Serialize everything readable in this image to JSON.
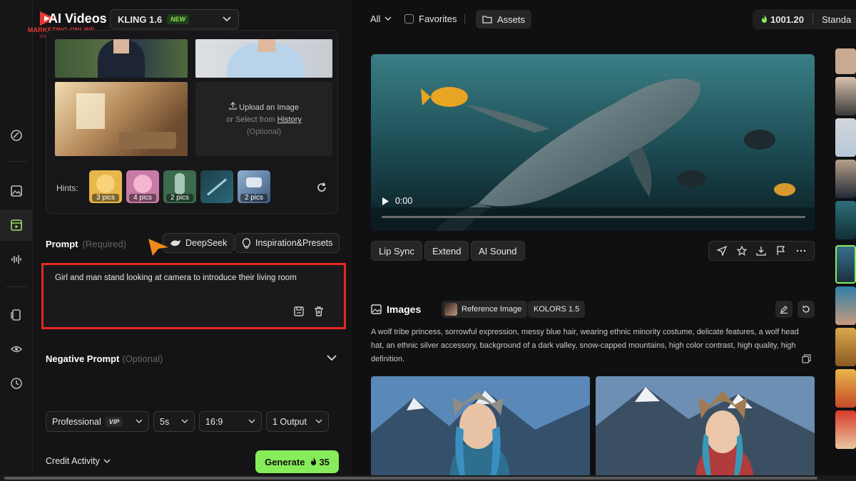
{
  "logo": {
    "line1": "MARKETING ONLINE",
    "line2": "Vươn Xa Cùng Bạn"
  },
  "header": {
    "title": "AI Videos",
    "model": "KLING 1.6",
    "model_badge": "NEW"
  },
  "upload": {
    "line1": "Upload an Image",
    "line2_prefix": "or Select from",
    "line2_link": "History",
    "line3": "(Optional)"
  },
  "hints": {
    "label": "Hints:",
    "items": [
      {
        "count": "3 pics",
        "color": "#e8b64a"
      },
      {
        "count": "4 pics",
        "color": "#c97aa6"
      },
      {
        "count": "2 pics",
        "color": "#3c6a4c"
      },
      {
        "count": "",
        "color": "#2b6a78"
      },
      {
        "count": "2 pics",
        "color": "#5f7fa6"
      }
    ]
  },
  "prompt": {
    "label": "Prompt",
    "required": "(Required)",
    "deepseek": "DeepSeek",
    "inspiration": "Inspiration&Presets",
    "text": "Girl and man stand looking at camera to introduce their living room"
  },
  "negative": {
    "label": "Negative Prompt",
    "optional": "(Optional)"
  },
  "options": {
    "mode": "Professional",
    "mode_badge": "VIP",
    "duration": "5s",
    "ratio": "16:9",
    "outputs": "1 Output"
  },
  "credit_activity": "Credit Activity",
  "generate": {
    "label": "Generate",
    "cost": "35"
  },
  "right_top": {
    "filter": "All",
    "favorites": "Favorites",
    "assets": "Assets",
    "credits": "1001.20",
    "plan": "Standa"
  },
  "video": {
    "time": "0:00"
  },
  "actions": {
    "lip_sync": "Lip Sync",
    "extend": "Extend",
    "ai_sound": "AI Sound"
  },
  "images": {
    "title": "Images",
    "reference": "Reference Image",
    "model": "KOLORS 1.5",
    "description": "A wolf tribe princess, sorrowful expression, messy blue hair, wearing ethnic minority costume, delicate features, a wolf head hat, an ethnic silver accessory, background of a dark valley, snow-capped mountains, high color contrast, high quality, high definition."
  },
  "colors": {
    "accent": "#86ec5a",
    "highlight": "#e8261f",
    "brand": "#e53935"
  }
}
